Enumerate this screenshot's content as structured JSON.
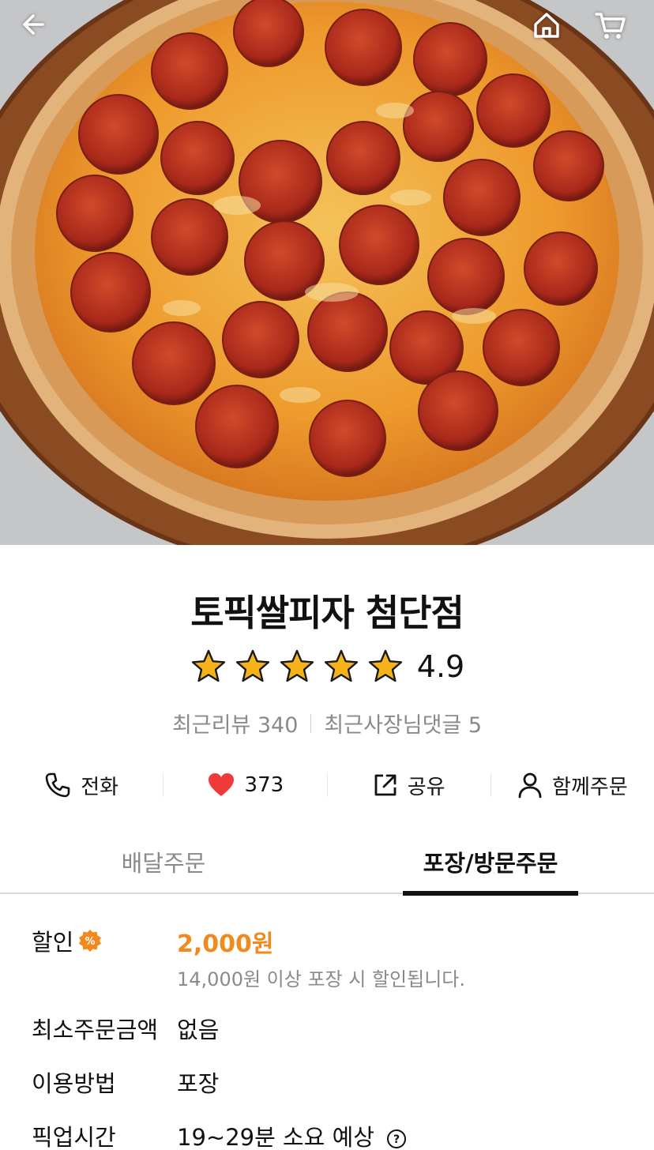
{
  "header": {
    "back_icon": "arrow-left-icon",
    "home_icon": "home-icon",
    "cart_icon": "cart-icon"
  },
  "store": {
    "name": "토픽쌀피자 첨단점",
    "rating": "4.9",
    "stars": 5,
    "recent_reviews": "최근리뷰 340",
    "owner_replies": "최근사장님댓글 5"
  },
  "actions": {
    "call": "전화",
    "likes": "373",
    "share": "공유",
    "group_order": "함께주문"
  },
  "tabs": [
    {
      "label": "배달주문",
      "active": false
    },
    {
      "label": "포장/방문주문",
      "active": true
    }
  ],
  "info": {
    "discount_label": "할인",
    "discount_amount": "2,000원",
    "discount_desc": "14,000원 이상 포장 시 할인됩니다.",
    "min_order_label": "최소주문금액",
    "min_order_value": "없음",
    "method_label": "이용방법",
    "method_value": "포장",
    "pickup_label": "픽업시간",
    "pickup_value": "19~29분 소요 예상"
  },
  "colors": {
    "accent": "#f08a1c",
    "star": "#f5b21a",
    "heart": "#f03a3a"
  }
}
